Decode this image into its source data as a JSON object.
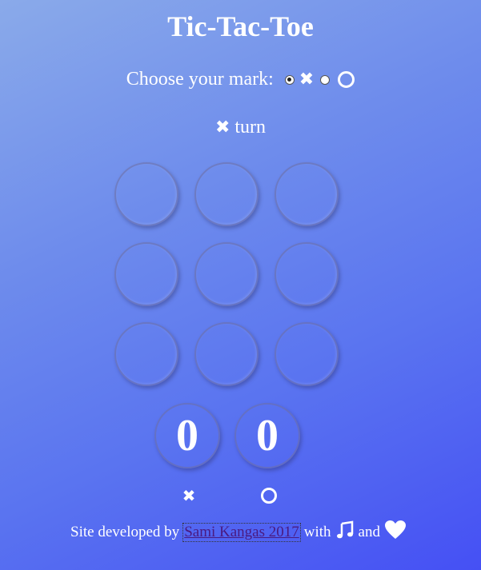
{
  "title": "Tic-Tac-Toe",
  "choose": {
    "label": "Choose your mark:",
    "options": [
      {
        "mark": "x-icon",
        "checked": true
      },
      {
        "mark": "o-icon",
        "checked": false
      }
    ]
  },
  "turn": {
    "mark": "x-icon",
    "text": "turn"
  },
  "board": {
    "cells": [
      "",
      "",
      "",
      "",
      "",
      "",
      "",
      "",
      ""
    ]
  },
  "scores": {
    "x": "0",
    "o": "0"
  },
  "footer": {
    "prefix": "Site developed by",
    "link_text": "Sami Kangas 2017",
    "with": "with",
    "and": "and",
    "icons": [
      "music-note-icon",
      "heart-icon"
    ]
  },
  "colors": {
    "background_start": "#8aaaea",
    "background_end": "#4550f4",
    "text": "#ffffff",
    "link": "#4a1a80"
  }
}
